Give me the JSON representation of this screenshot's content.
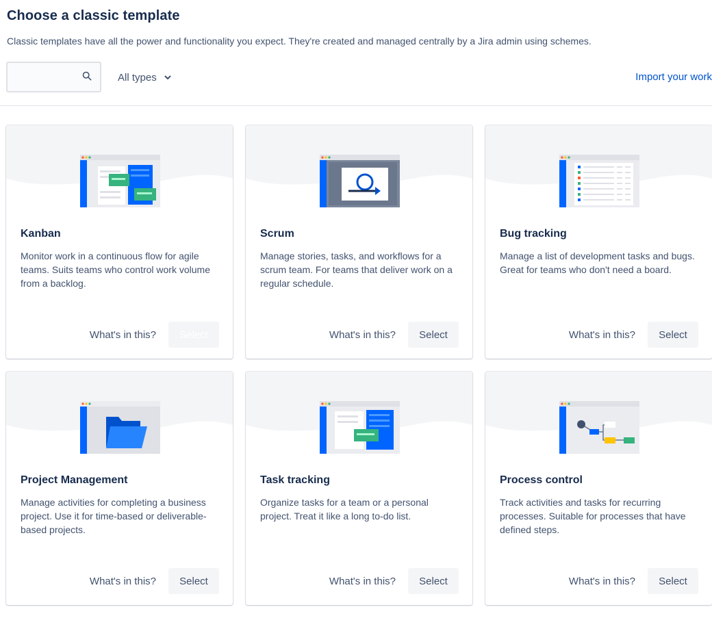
{
  "header": {
    "title": "Choose a classic template",
    "subtitle": "Classic templates have all the power and functionality you expect. They're created and managed centrally by a Jira admin using schemes."
  },
  "toolbar": {
    "search_value": "",
    "search_icon": "search-icon",
    "filter_label": "All types",
    "import_label": "Import your work"
  },
  "colors": {
    "accent": "#0052cc",
    "brand_blue": "#0065ff",
    "green": "#36b37e",
    "yellow": "#ffc400",
    "red": "#ff5630"
  },
  "templates": [
    {
      "title": "Kanban",
      "description": "Monitor work in a continuous flow for agile teams. Suits teams who control work volume from a backlog.",
      "whats_in": "What's in this?",
      "select": "Select",
      "select_state": "disabled"
    },
    {
      "title": "Scrum",
      "description": "Manage stories, tasks, and workflows for a scrum team. For teams that deliver work on a regular schedule.",
      "whats_in": "What's in this?",
      "select": "Select",
      "select_state": "enabled"
    },
    {
      "title": "Bug tracking",
      "description": "Manage a list of development tasks and bugs. Great for teams who don't need a board.",
      "whats_in": "What's in this?",
      "select": "Select",
      "select_state": "enabled"
    },
    {
      "title": "Project Management",
      "description": "Manage activities for completing a business project. Use it for time-based or deliverable-based projects.",
      "whats_in": "What's in this?",
      "select": "Select",
      "select_state": "enabled"
    },
    {
      "title": "Task tracking",
      "description": "Organize tasks for a team or a personal project. Treat it like a long to-do list.",
      "whats_in": "What's in this?",
      "select": "Select",
      "select_state": "enabled"
    },
    {
      "title": "Process control",
      "description": "Track activities and tasks for recurring processes. Suitable for processes that have defined steps.",
      "whats_in": "What's in this?",
      "select": "Select",
      "select_state": "enabled"
    }
  ]
}
